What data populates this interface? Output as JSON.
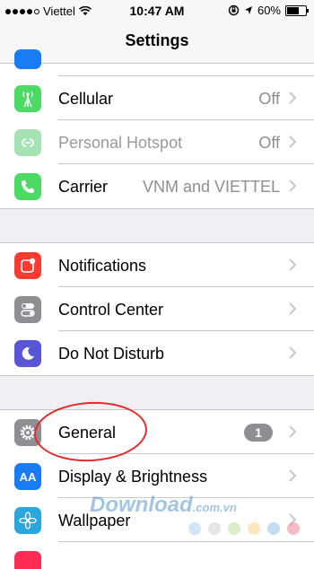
{
  "status_bar": {
    "carrier": "Viettel",
    "time": "10:47 AM",
    "battery": "60%",
    "battery_level": 0.6
  },
  "nav": {
    "title": "Settings"
  },
  "groups": [
    {
      "rows": [
        {
          "label": "Cellular",
          "value": "Off",
          "icon": "antenna-icon",
          "color": "#4cd964"
        },
        {
          "label": "Personal Hotspot",
          "value": "Off",
          "icon": "hotspot-link-icon",
          "color": "#a6e3b4",
          "dimmed": true
        },
        {
          "label": "Carrier",
          "value": "VNM and VIETTEL",
          "icon": "phone-icon",
          "color": "#4cd964"
        }
      ]
    },
    {
      "rows": [
        {
          "label": "Notifications",
          "icon": "notifications-icon",
          "color": "#ff3b30"
        },
        {
          "label": "Control Center",
          "icon": "toggles-icon",
          "color": "#8e8e93"
        },
        {
          "label": "Do Not Disturb",
          "icon": "moon-icon",
          "color": "#5856d6"
        }
      ]
    },
    {
      "rows": [
        {
          "label": "General",
          "badge": "1",
          "icon": "gear-icon",
          "color": "#8e8e93"
        },
        {
          "label": "Display & Brightness",
          "icon": "text-size-icon",
          "color": "#1a7cf4",
          "icon_text": "AA"
        },
        {
          "label": "Wallpaper",
          "icon": "flower-icon",
          "color": "#2aa6dd"
        }
      ]
    }
  ],
  "watermark": {
    "text": "Download",
    "suffix": ".com.vn"
  },
  "colors": {
    "accent_annotation": "#e5292d",
    "background": "#efeff4"
  }
}
